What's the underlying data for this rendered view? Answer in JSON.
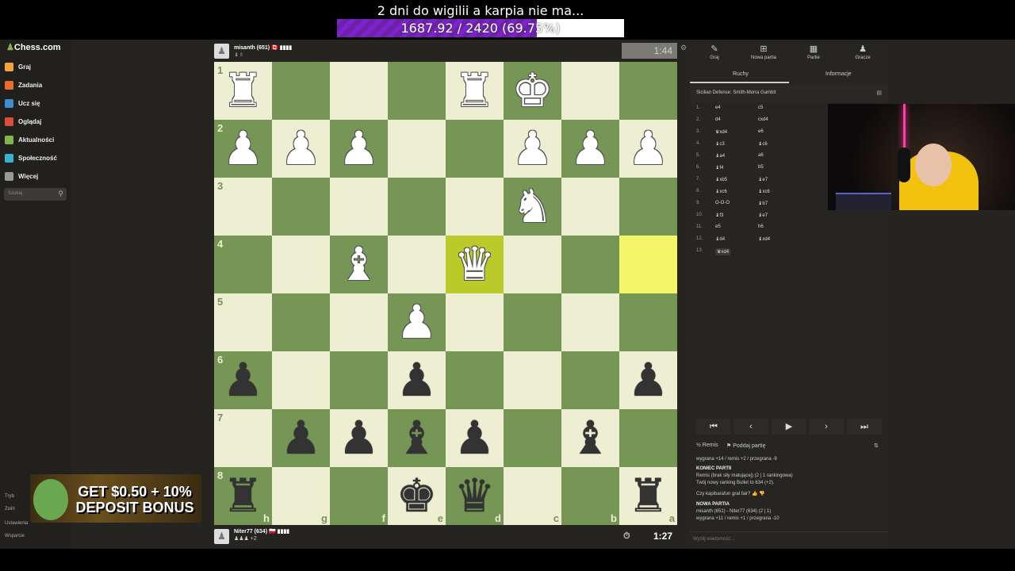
{
  "stream": {
    "donation_title": "2 dni do wigilii a karpia nie ma...",
    "donation_progress_text": "1687.92 / 2420 (69.75%)",
    "donation_fraction": 0.6975
  },
  "sidebar": {
    "logo": "Chess.com",
    "items": [
      {
        "label": "Graj",
        "color": "#f2a33a"
      },
      {
        "label": "Zadania",
        "color": "#e86e29"
      },
      {
        "label": "Ucz się",
        "color": "#3b8fd0"
      },
      {
        "label": "Oglądaj",
        "color": "#d94f3a"
      },
      {
        "label": "Aktualności",
        "color": "#81b64c"
      },
      {
        "label": "Społeczność",
        "color": "#3bb0d0"
      },
      {
        "label": "Więcej",
        "color": "#999999"
      }
    ],
    "search_placeholder": "Szukaj",
    "bottom_items": [
      "Tryb",
      "Zwiń",
      "Ustawienia",
      "Wsparcie"
    ]
  },
  "ad": {
    "line1": "GET $0.50 + 10%",
    "line2": "DEPOSIT BONUS"
  },
  "top_player": {
    "name": "misanth (651) 🇨🇦 ▮▮▮▮",
    "captures": "♝♗",
    "clock": "1:44"
  },
  "bottom_player": {
    "name": "Niter77 (634) 🇵🇱 ▮▮▮▮",
    "captures": "♟♟♟ +2",
    "clock": "1:27"
  },
  "board": {
    "ranks": [
      "1",
      "2",
      "3",
      "4",
      "5",
      "6",
      "7",
      "8"
    ],
    "files": [
      "h",
      "g",
      "f",
      "e",
      "d",
      "c",
      "b",
      "a"
    ],
    "highlight_last_from": [
      3,
      7
    ],
    "highlight_last_to": [
      3,
      4
    ],
    "pieces": [
      [
        0,
        0,
        "w",
        "♜"
      ],
      [
        0,
        4,
        "w",
        "♜"
      ],
      [
        0,
        5,
        "w",
        "♚"
      ],
      [
        1,
        0,
        "w",
        "♟"
      ],
      [
        1,
        1,
        "w",
        "♟"
      ],
      [
        1,
        2,
        "w",
        "♟"
      ],
      [
        1,
        5,
        "w",
        "♟"
      ],
      [
        1,
        6,
        "w",
        "♟"
      ],
      [
        1,
        7,
        "w",
        "♟"
      ],
      [
        2,
        5,
        "w",
        "♞"
      ],
      [
        3,
        2,
        "w",
        "♝"
      ],
      [
        3,
        4,
        "w",
        "♛"
      ],
      [
        4,
        3,
        "w",
        "♟"
      ],
      [
        5,
        0,
        "b",
        "♟"
      ],
      [
        5,
        3,
        "b",
        "♟"
      ],
      [
        5,
        7,
        "b",
        "♟"
      ],
      [
        6,
        1,
        "b",
        "♟"
      ],
      [
        6,
        2,
        "b",
        "♟"
      ],
      [
        6,
        3,
        "b",
        "♝"
      ],
      [
        6,
        4,
        "b",
        "♟"
      ],
      [
        6,
        6,
        "b",
        "♝"
      ],
      [
        7,
        0,
        "b",
        "♜"
      ],
      [
        7,
        3,
        "b",
        "♚"
      ],
      [
        7,
        4,
        "b",
        "♛"
      ],
      [
        7,
        7,
        "b",
        "♜"
      ]
    ]
  },
  "panel": {
    "tabs": [
      {
        "label": "Graj",
        "icon": "✎"
      },
      {
        "label": "Nowa partia",
        "icon": "⊞"
      },
      {
        "label": "Partie",
        "icon": "▦"
      },
      {
        "label": "Gracze",
        "icon": "♟"
      }
    ],
    "subtabs": [
      "Ruchy",
      "Informacje"
    ],
    "opening": "Sicilian Defense: Smith-Morra Gambit",
    "moves": [
      [
        "1.",
        "e4",
        "c5"
      ],
      [
        "2.",
        "d4",
        "cxd4"
      ],
      [
        "3.",
        "♛xd4",
        "e6"
      ],
      [
        "4.",
        "♝c3",
        "♝c6"
      ],
      [
        "5.",
        "♝a4",
        "a6"
      ],
      [
        "6.",
        "♝f4",
        "b5"
      ],
      [
        "7.",
        "♝xb5",
        "♝e7"
      ],
      [
        "8.",
        "♝xc6",
        "♝xc6"
      ],
      [
        "9.",
        "O-O-O",
        "♝b7"
      ],
      [
        "10.",
        "♝f3",
        "♝e7"
      ],
      [
        "11.",
        "e5",
        "h6"
      ],
      [
        "12.",
        "♝d4",
        "♝xd4"
      ],
      [
        "13.",
        "♛xd4",
        ""
      ]
    ],
    "controls": [
      "⏮",
      "‹",
      "▶",
      "›",
      "⏭"
    ],
    "draw": "Remis",
    "resign": "Poddaj partię",
    "log": [
      "wygrana +14 / remis +2 / przegrana -9",
      "KONIEC PARTII",
      "Remis (brak siły matującej) (2 | 1 rankingowa)",
      "Twój nowy ranking Bullet to 634 (+2).",
      "Czy kapibarafun grał fair?",
      "NOWA PARTIA",
      "misanth (651) - Niter77 (634) (2 | 1)",
      "wygrana +11 / remis +1 / przegrana -10"
    ],
    "chat_placeholder": "Wyślij wiadomość..."
  }
}
